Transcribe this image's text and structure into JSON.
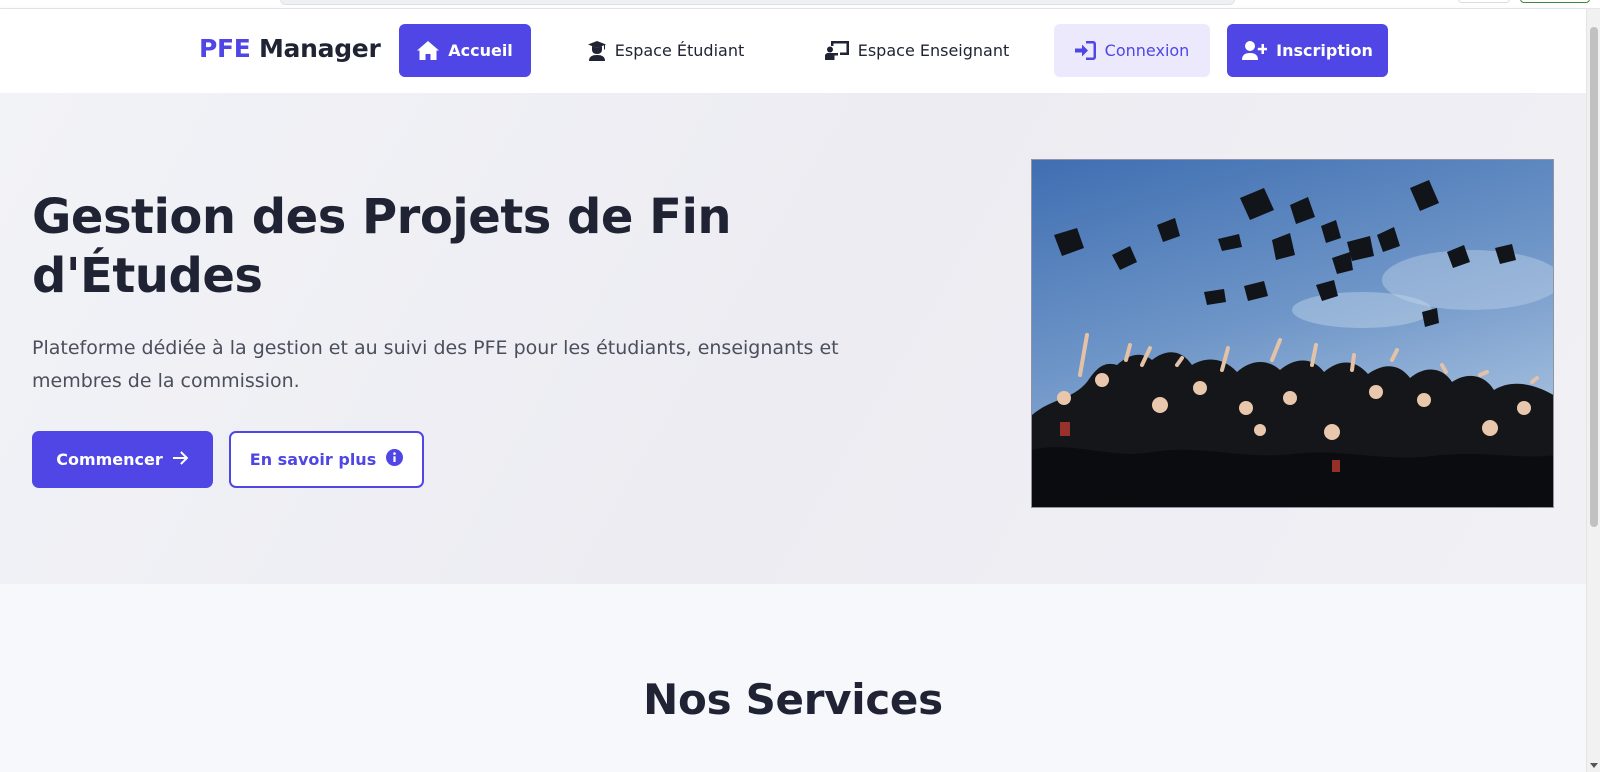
{
  "brand": {
    "part1": "PFE",
    "part2": "Manager"
  },
  "nav": {
    "home": {
      "label": "Accueil",
      "icon": "home-icon"
    },
    "student": {
      "label": "Espace Étudiant",
      "icon": "user-graduate-icon"
    },
    "teacher": {
      "label": "Espace Enseignant",
      "icon": "chalkboard-teacher-icon"
    },
    "login": {
      "label": "Connexion",
      "icon": "sign-in-icon"
    },
    "register": {
      "label": "Inscription",
      "icon": "user-plus-icon"
    }
  },
  "hero": {
    "title": "Gestion des Projets de Fin d'Études",
    "subtitle": "Plateforme dédiée à la gestion et au suivi des PFE pour les étudiants, enseignants et membres de la commission.",
    "primary_button": {
      "label": "Commencer",
      "icon": "arrow-right-icon"
    },
    "secondary_button": {
      "label": "En savoir plus",
      "icon": "info-circle-icon"
    },
    "image": "graduation-caps-thrown-photo"
  },
  "services": {
    "title": "Nos Services"
  },
  "colors": {
    "accent": "#4f46e5",
    "accent_light": "#ebe9fb",
    "text_dark": "#1f2333",
    "text_muted": "#4b4f5c"
  }
}
